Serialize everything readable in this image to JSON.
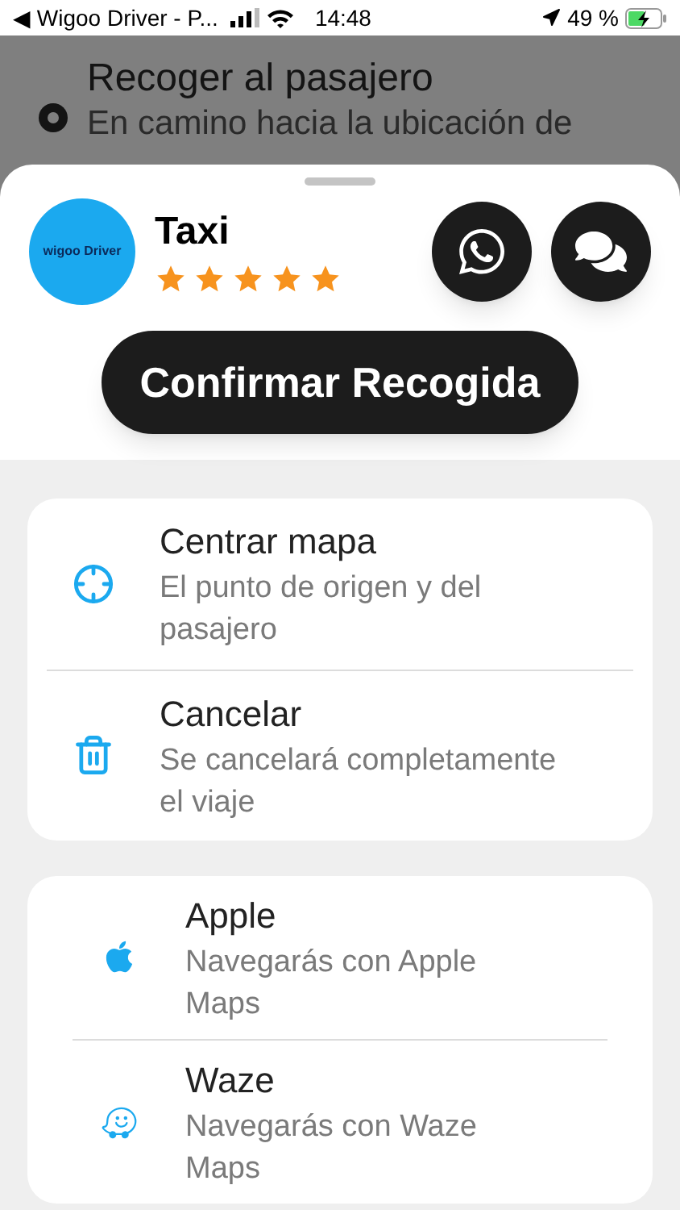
{
  "status_bar": {
    "back_app": "◀ Wigoo Driver - P...",
    "time": "14:48",
    "battery": "49 %"
  },
  "background": {
    "title": "Recoger al pasajero",
    "subtitle": "En camino hacia la ubicación de"
  },
  "driver": {
    "logo": "wigoo Driver",
    "name": "Taxi",
    "stars": 5
  },
  "confirm_button": "Confirmar Recogida",
  "actions": [
    {
      "title": "Centrar mapa",
      "subtitle": "El punto de origen y del pasajero"
    },
    {
      "title": "Cancelar",
      "subtitle": "Se cancelará completamente el viaje"
    }
  ],
  "navigation": [
    {
      "title": "Apple",
      "subtitle": "Navegarás con Apple Maps"
    },
    {
      "title": "Waze",
      "subtitle": "Navegarás con Waze Maps"
    }
  ]
}
